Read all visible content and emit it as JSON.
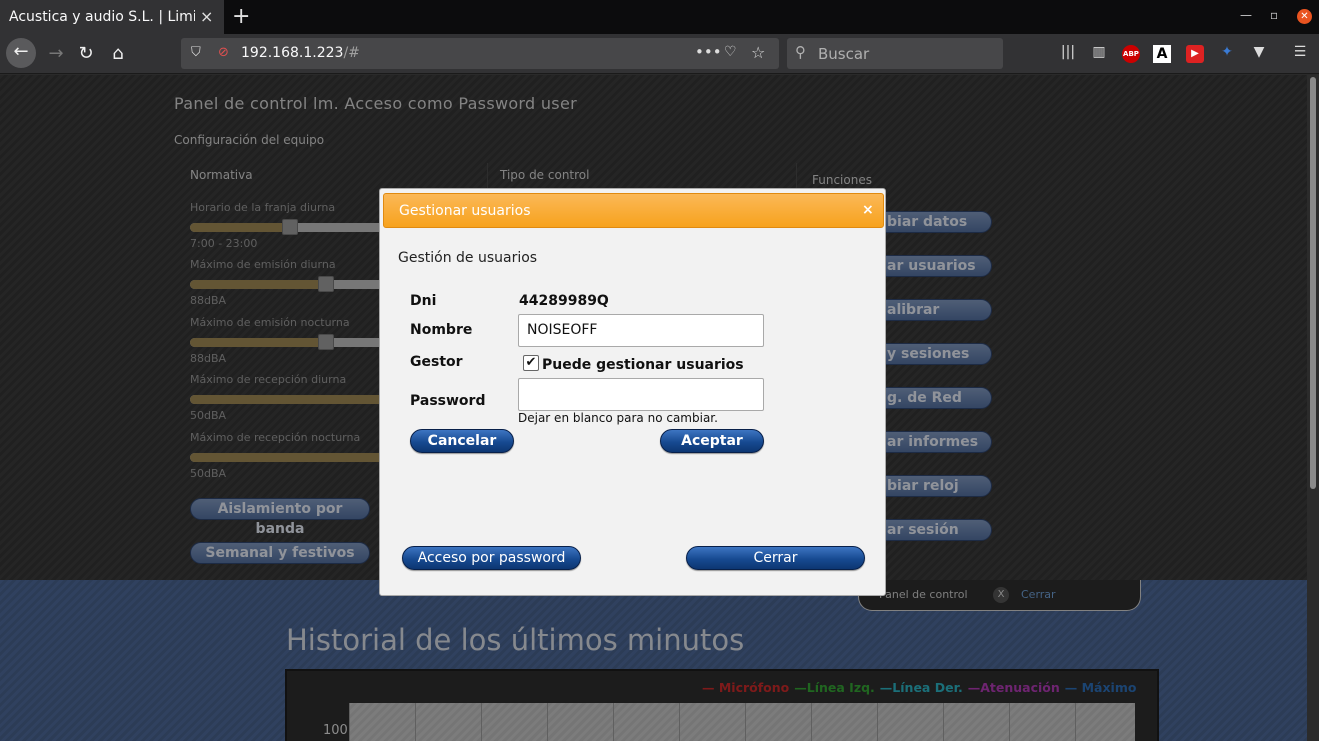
{
  "browser": {
    "tab_title": "Acustica y audio S.L. | Limitador",
    "tab_close": "×",
    "new_tab": "+",
    "url_host": "192.168.1.223",
    "url_path": "/#",
    "search_placeholder": "Buscar",
    "abp_label": "ABP",
    "ext_a_label": "A"
  },
  "panel": {
    "title": "Panel de control lm. Acceso como Password user",
    "config_title": "Configuración del equipo",
    "col_normativa": "Normativa",
    "col_tipo": "Tipo de control",
    "col_funciones": "Funciones",
    "sliders": [
      {
        "label": "Horario de la franja diurna",
        "value_text": "7:00 - 23:00",
        "fill": 0.5
      },
      {
        "label": "Máximo de emisión diurna",
        "value_text": "88dBA",
        "fill": 0.68
      },
      {
        "label": "Máximo de emisión nocturna",
        "value_text": "88dBA",
        "fill": 0.68
      },
      {
        "label": "Máximo de recepción diurna",
        "value_text": "50dBA",
        "fill": 1.0
      },
      {
        "label": "Máximo de recepción nocturna",
        "value_text": "50dBA",
        "fill": 1.0
      }
    ],
    "btn_aislamiento": "Aislamiento por banda",
    "btn_semanal": "Semanal y festivos",
    "functions": [
      "biar datos",
      "ar usuarios",
      "alibrar",
      "y sesiones",
      "g. de Red",
      "ar informes",
      "biar reloj",
      "ar sesión"
    ]
  },
  "subtab": {
    "label": "Panel de control",
    "close_x": "X",
    "close_text": "Cerrar"
  },
  "history": {
    "title": "Historial de los últimos minutos",
    "legend": [
      {
        "text": "— Micrófono",
        "color": "#cc2b2b"
      },
      {
        "text": "—Línea Izq.",
        "color": "#35a535"
      },
      {
        "text": "—Línea Der.",
        "color": "#2db4c4"
      },
      {
        "text": "—Atenuación",
        "color": "#b23bb6"
      },
      {
        "text": "— Máximo",
        "color": "#2d6fb8"
      }
    ],
    "y_tick": "100"
  },
  "modal": {
    "title": "Gestionar usuarios",
    "close": "×",
    "subtitle": "Gestión de usuarios",
    "dni_label": "Dni",
    "dni_value": "44289989Q",
    "nombre_label": "Nombre",
    "nombre_value": "NOISEOFF",
    "gestor_label": "Gestor",
    "gestor_checked": true,
    "gestor_check_mark": "✔",
    "gestor_option": "Puede gestionar usuarios",
    "password_label": "Password",
    "password_value": "",
    "password_hint": "Dejar en blanco para no cambiar.",
    "cancel": "Cancelar",
    "accept": "Aceptar",
    "access_password": "Acceso por password",
    "close_btn": "Cerrar"
  },
  "colors": {
    "modal_header": "#f7a21d",
    "button_blue": "#174a91",
    "page_blue": "#4e6a99"
  }
}
